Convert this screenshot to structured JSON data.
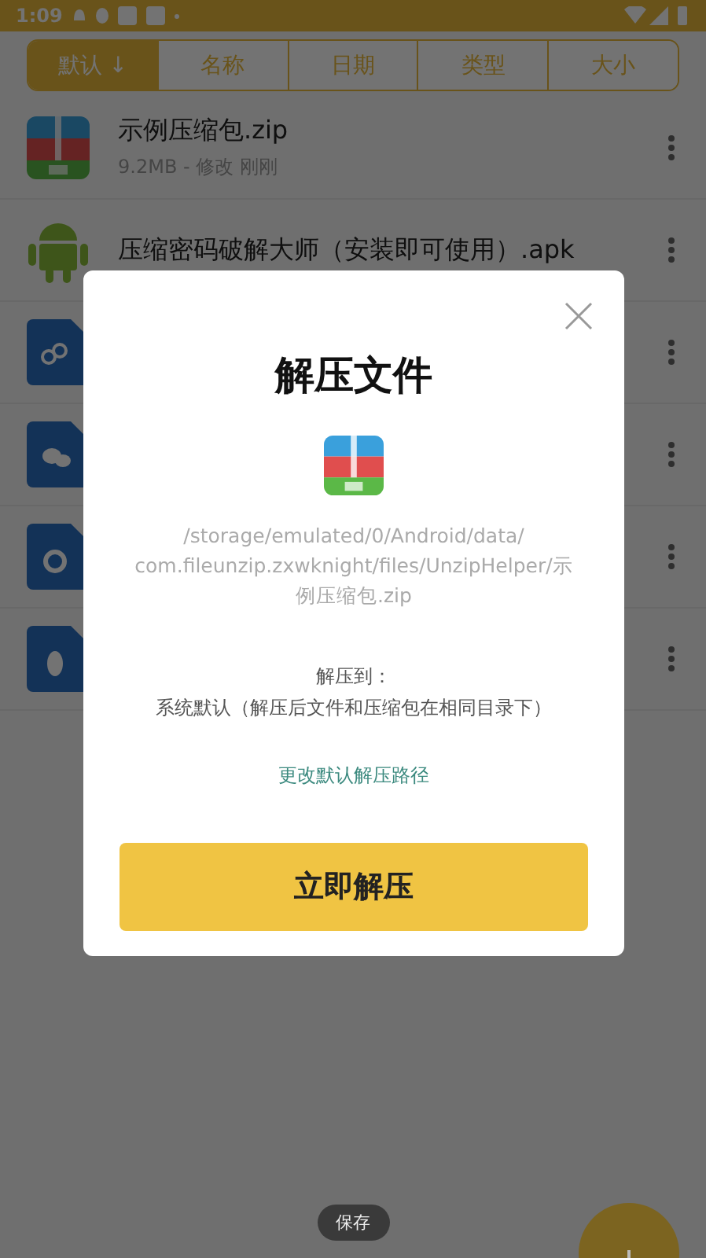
{
  "status_bar": {
    "time": "1:09"
  },
  "sort_tabs": [
    {
      "label": "默认 ↓",
      "selected": true
    },
    {
      "label": "名称",
      "selected": false
    },
    {
      "label": "日期",
      "selected": false
    },
    {
      "label": "类型",
      "selected": false
    },
    {
      "label": "大小",
      "selected": false
    }
  ],
  "files": [
    {
      "kind": "zip",
      "name": "示例压缩包.zip",
      "meta": "9.2MB - 修改 刚刚"
    },
    {
      "kind": "apk",
      "name": "压缩密码破解大师（安装即可使用）.apk"
    },
    {
      "kind": "link"
    },
    {
      "kind": "chat"
    },
    {
      "kind": "ring"
    },
    {
      "kind": "penguin"
    }
  ],
  "dialog": {
    "title": "解压文件",
    "path": "/storage/emulated/0/Android/data/com.fileunzip.zxwknight/files/UnzipHelper/示例压缩包.zip",
    "target_label": "解压到：",
    "target": "系统默认（解压后文件和压缩包在相同目录下）",
    "change_link": "更改默认解压路径",
    "confirm_button": "立即解压"
  },
  "toast": "保存"
}
